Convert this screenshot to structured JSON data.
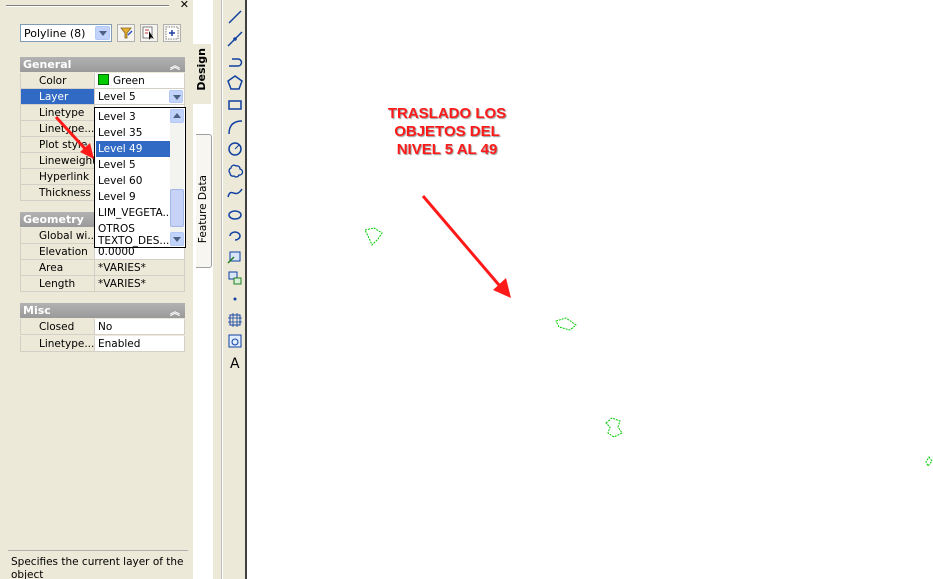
{
  "colors": {
    "accent": "#316ac5",
    "annotation": "#ff1a1a",
    "green_swatch": "#00cc00",
    "entity": "#00cc00"
  },
  "selection": {
    "value": "Polyline (8)"
  },
  "toolbar_buttons": [
    "quick-select-icon",
    "select-objects-icon",
    "toggle-pickadd-icon"
  ],
  "sections": {
    "general": "General",
    "geometry": "Geometry",
    "misc": "Misc"
  },
  "general_rows": [
    {
      "label": "Color",
      "value": "Green"
    },
    {
      "label": "Layer",
      "value": "Level 5"
    },
    {
      "label": "Linetype",
      "value": ""
    },
    {
      "label": "Linetype...",
      "value": ""
    },
    {
      "label": "Plot style",
      "value": ""
    },
    {
      "label": "Lineweight",
      "value": ""
    },
    {
      "label": "Hyperlink",
      "value": ""
    },
    {
      "label": "Thickness",
      "value": ""
    }
  ],
  "geometry_rows": [
    {
      "label": "Global wi...",
      "value": ""
    },
    {
      "label": "Elevation",
      "value": "0.0000"
    },
    {
      "label": "Area",
      "value": "*VARIES*"
    },
    {
      "label": "Length",
      "value": "*VARIES*"
    }
  ],
  "misc_rows": [
    {
      "label": "Closed",
      "value": "No"
    },
    {
      "label": "Linetype...",
      "value": "Enabled"
    }
  ],
  "layer_dropdown": {
    "items": [
      "Level 3",
      "Level 35",
      "Level 49",
      "Level 5",
      "Level 60",
      "Level 9",
      "LIM_VEGETA...",
      "OTROS",
      "TEXTO_DES..."
    ],
    "highlighted": "Level 49"
  },
  "description": "Specifies the current layer of the object",
  "tabs": {
    "design": "Design",
    "feature": "Feature Data"
  },
  "draw_tools": [
    "line-icon",
    "construction-line-icon",
    "polyline-icon",
    "polygon-icon",
    "rectangle-icon",
    "arc-icon",
    "circle-icon",
    "revision-cloud-icon",
    "spline-icon",
    "ellipse-icon",
    "ellipse-arc-icon",
    "insert-block-icon",
    "make-block-icon",
    "point-icon",
    "hatch-icon",
    "region-icon",
    "multiline-text-icon"
  ],
  "annotation": {
    "lines": [
      "TRASLADO LOS",
      "OBJETOS DEL",
      "NIVEL 5 AL 49"
    ]
  }
}
